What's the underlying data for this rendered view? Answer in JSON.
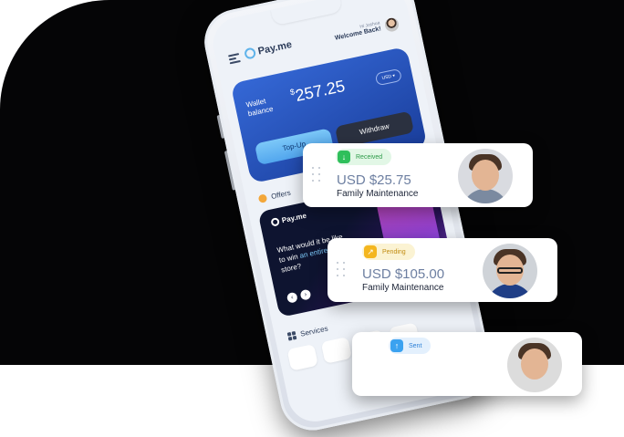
{
  "app": {
    "logo_text": "Pay.me",
    "greeting_small": "Hi Joshua",
    "greeting": "Welcome Back!"
  },
  "wallet": {
    "label": "Wallet balance",
    "currency_symbol": "$",
    "amount": "257.25",
    "currency_selector": "USD",
    "topup_label": "Top-Up",
    "withdraw_label": "Withdraw"
  },
  "offers": {
    "title": "Offers",
    "promo_logo": "Pay.me",
    "promo_text_1": "What would it be like to win ",
    "promo_text_highlight": "an entire",
    "promo_text_2": " app store?",
    "prev": "‹",
    "next": "›"
  },
  "services": {
    "title": "Services"
  },
  "transactions": [
    {
      "status": "Received",
      "status_icon": "↓",
      "amount": "USD $25.75",
      "description": "Family Maintenance",
      "status_color": "#2fbf5b"
    },
    {
      "status": "Pending",
      "status_icon": "↗",
      "amount": "USD $105.00",
      "description": "Family Maintenance",
      "status_color": "#f4b61e"
    },
    {
      "status": "Sent",
      "status_icon": "↑",
      "amount": "",
      "description": "",
      "status_color": "#3ba2f0"
    }
  ],
  "colors": {
    "background": "#050506",
    "wallet_card": "#2a58c4",
    "amount_text": "#6d7fa1"
  }
}
